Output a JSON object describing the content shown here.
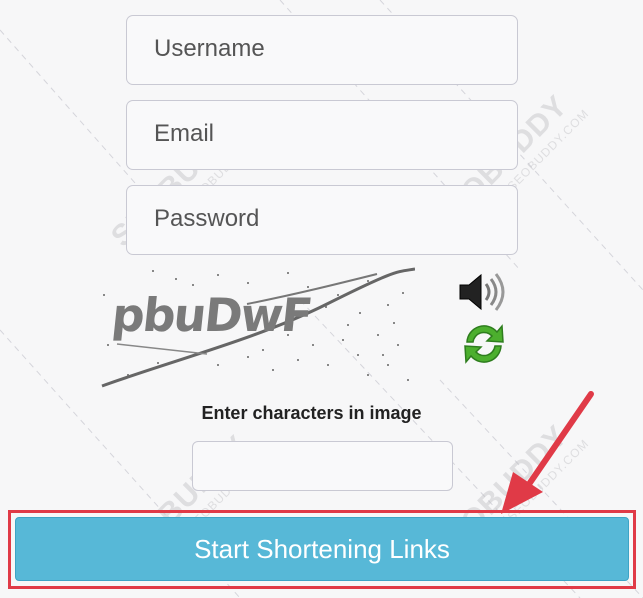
{
  "form": {
    "username_placeholder": "Username",
    "email_placeholder": "Email",
    "password_placeholder": "Password"
  },
  "captcha": {
    "image_text": "pbuDwF",
    "audio_icon": "speaker-icon",
    "refresh_icon": "refresh-icon",
    "label": "Enter characters in image",
    "input_value": ""
  },
  "submit": {
    "label": "Start Shortening Links"
  },
  "watermark": {
    "brand": "SEOBUDDY",
    "url": "WWW.SEOBUDDY.COM"
  },
  "colors": {
    "button": "#57b8d7",
    "highlight": "#e03a47",
    "refresh": "#4caf2e"
  }
}
